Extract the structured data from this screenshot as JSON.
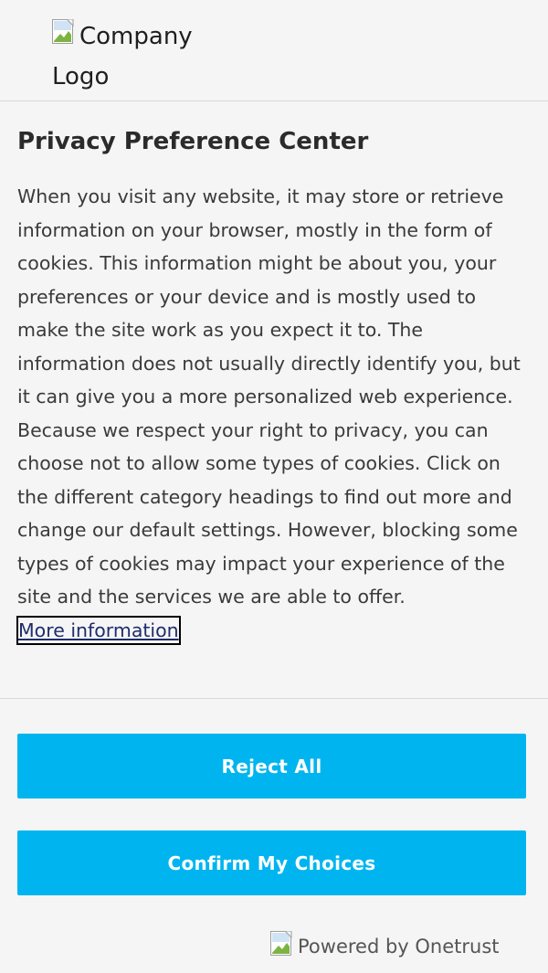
{
  "header": {
    "logo_alt_line1": "Company",
    "logo_alt_line2": "Logo",
    "logo_icon": "broken-image-icon"
  },
  "main": {
    "title": "Privacy Preference Center",
    "description": "When you visit any website, it may store or retrieve information on your browser, mostly in the form of cookies. This information might be about you, your preferences or your device and is mostly used to make the site work as you expect it to. The information does not usually directly identify you, but it can give you a more personalized web experience. Because we respect your right to privacy, you can choose not to allow some types of cookies. Click on the different category headings to find out more and change our default settings. However, blocking some types of cookies may impact your experience of the site and the services we are able to offer.",
    "more_info_label": "More information"
  },
  "actions": {
    "reject_label": "Reject All",
    "confirm_label": "Confirm My Choices",
    "button_color": "#00b5ef"
  },
  "footer": {
    "powered_by_alt": "Powered by Onetrust",
    "powered_icon": "broken-image-icon"
  }
}
